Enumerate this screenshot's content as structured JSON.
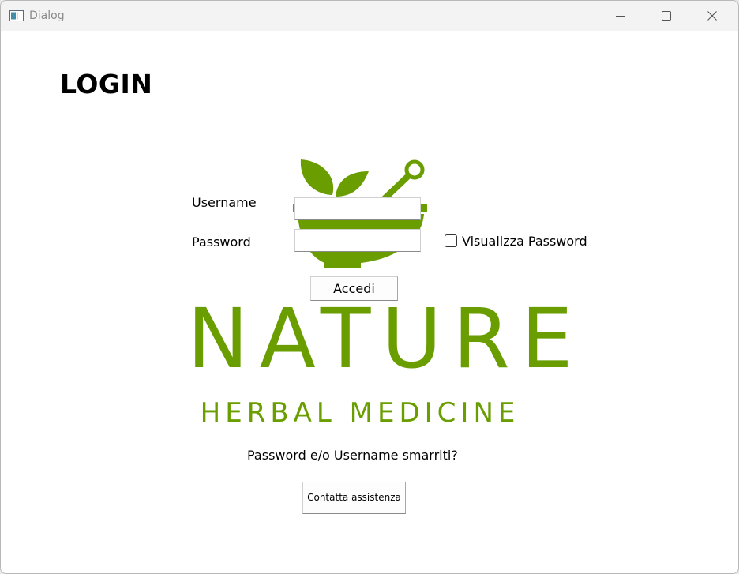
{
  "window": {
    "title": "Dialog",
    "icon": "app-window-icon",
    "controls": [
      "minimize-icon",
      "maximize-icon",
      "close-icon"
    ]
  },
  "main": {
    "heading": "LOGIN",
    "username_label": "Username",
    "username_value": "",
    "password_label": "Password",
    "password_value": "",
    "show_password_label": "Visualizza Password",
    "show_password_checked": false,
    "submit_label": "Accedi",
    "lost_credentials_text": "Password e/o Username smarriti?",
    "support_button_label": "Contatta assistenza"
  },
  "logo": {
    "word": "NATURE",
    "tagline": "HERBAL MEDICINE",
    "icon": "mortar-pestle-leaves-icon",
    "color": "#6a9e00"
  },
  "colors": {
    "window_bg": "#ffffff",
    "titlebar_bg": "#f3f3f3",
    "brand_green": "#6a9e00"
  }
}
